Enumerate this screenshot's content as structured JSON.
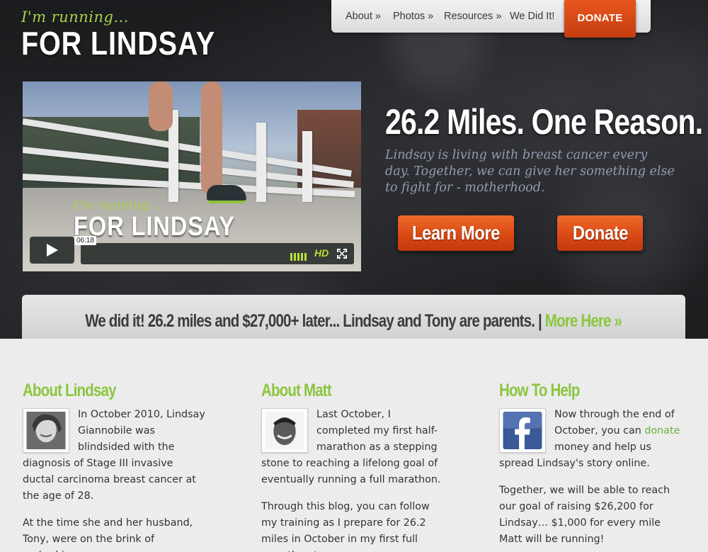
{
  "logo": {
    "tagline": "I'm running...",
    "name": "FOR LINDSAY"
  },
  "nav": {
    "items": [
      "About »",
      "Photos »",
      "Resources »",
      "We Did It!"
    ],
    "donate": "DONATE"
  },
  "video": {
    "logo_tagline": "I'm running...",
    "logo_name": "FOR LINDSAY",
    "time": "06:18",
    "hd_label": "HD",
    "icons": [
      "play-icon",
      "volume-icon",
      "hd-icon",
      "fullscreen-icon"
    ]
  },
  "hero": {
    "headline": "26.2 Miles. One Reason.",
    "tagline": "Lindsay is living with breast cancer every day. Together, we can give her something else to fight for - motherhood.",
    "learn_more": "Learn More",
    "donate": "Donate"
  },
  "announcement": {
    "text": "We did it! 26.2 miles and $27,000+ later... Lindsay and Tony are parents. | ",
    "link": "More Here »"
  },
  "columns": {
    "about_lindsay": {
      "title": "About Lindsay",
      "p1": "In October 2010, Lindsay Giannobile was blindsided with the diagnosis of Stage III invasive ductal carcinoma breast cancer at the age of 28.",
      "p2": "At the time she and her husband, Tony, were on the brink of embarking"
    },
    "about_matt": {
      "title": "About Matt",
      "p1": "Last October, I completed my first half-marathon as a stepping stone to reaching a lifelong goal of eventually running a full marathon.",
      "p2": "Through this blog, you can follow my training as I prepare for 26.2 miles in October in my first full marathon to"
    },
    "how_to_help": {
      "title": "How To Help",
      "p1_before": "Now through the end of October, you can ",
      "p1_link": "donate",
      "p1_after": " money and help us spread Lindsay's story online.",
      "p2": "Together, we will be able to reach our goal of raising $26,200 for Lindsay… $1,000 for every mile Matt will be running!"
    }
  },
  "colors": {
    "accent_green": "#8cc63f",
    "donate_orange": "#d84712",
    "hero_dark": "#1d1e20"
  }
}
